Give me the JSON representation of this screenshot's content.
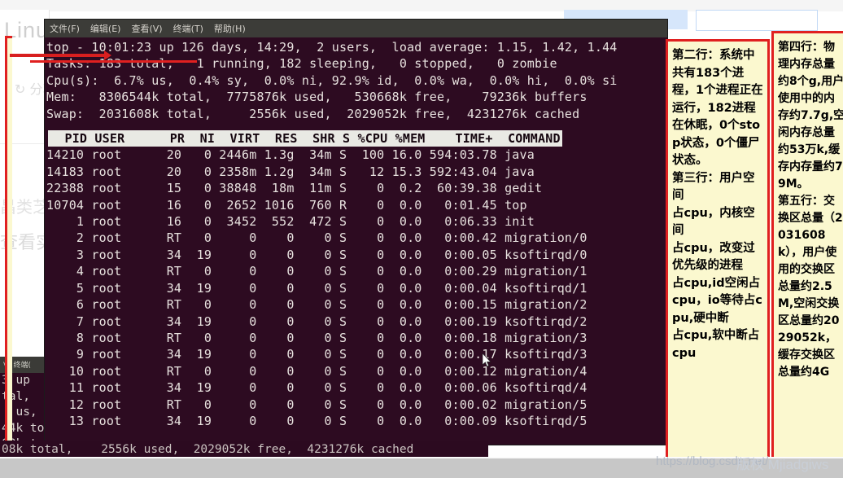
{
  "background": {
    "site_word": "Linux",
    "share_label": "↻ 分享",
    "ghost_text_1": "昌类芝麻",
    "ghost_text_2": "查看实",
    "watermark": "https://blog.csdn.net/",
    "watermark_author": "版权  Mjiadgiws"
  },
  "terminal": {
    "menu": [
      {
        "label": "文件(F)"
      },
      {
        "label": "编辑(E)"
      },
      {
        "label": "查看(V)"
      },
      {
        "label": "终端(T)"
      },
      {
        "label": "帮助(H)"
      }
    ],
    "summary_lines": [
      "top - 10:01:23 up 126 days, 14:29,  2 users,  load average: 1.15, 1.42, 1.44",
      "Tasks: 183 total,   1 running, 182 sleeping,   0 stopped,   0 zombie",
      "Cpu(s):  6.7% us,  0.4% sy,  0.0% ni, 92.9% id,  0.0% wa,  0.0% hi,  0.0% si",
      "Mem:   8306544k total,  7775876k used,   530668k free,    79236k buffers",
      "Swap:  2031608k total,     2556k used,  2029052k free,  4231276k cached"
    ],
    "table_header": "  PID USER      PR  NI  VIRT  RES  SHR S %CPU %MEM    TIME+  COMMAND",
    "rows": [
      "14210 root      20   0 2446m 1.3g  34m S  100 16.0 594:03.78 java",
      "14183 root      20   0 2358m 1.2g  34m S   12 15.3 592:43.04 java",
      "22388 root      15   0 38848  18m  11m S    0  0.2  60:39.38 gedit",
      "10704 root      16   0  2652 1016  760 R    0  0.0   0:01.45 top",
      "    1 root      16   0  3452  552  472 S    0  0.0   0:06.33 init",
      "    2 root      RT   0     0    0    0 S    0  0.0   0:00.42 migration/0",
      "    3 root      34  19     0    0    0 S    0  0.0   0:00.05 ksoftirqd/0",
      "    4 root      RT   0     0    0    0 S    0  0.0   0:00.29 migration/1",
      "    5 root      34  19     0    0    0 S    0  0.0   0:00.04 ksoftirqd/1",
      "    6 root      RT   0     0    0    0 S    0  0.0   0:00.15 migration/2",
      "    7 root      34  19     0    0    0 S    0  0.0   0:00.19 ksoftirqd/2",
      "    8 root      RT   0     0    0    0 S    0  0.0   0:00.18 migration/3",
      "    9 root      34  19     0    0    0 S    0  0.0   0:00.17 ksoftirqd/3",
      "   10 root      RT   0     0    0    0 S    0  0.0   0:00.12 migration/4",
      "   11 root      34  19     0    0    0 S    0  0.0   0:00.06 ksoftirqd/4",
      "   12 root      RT   0     0    0    0 S    0  0.0   0:00.02 migration/5",
      "   13 root      34  19     0    0    0 S    0  0.0   0:00.09 ksoftirqd/5"
    ]
  },
  "back_terminal": {
    "menu_fragment": "V) 终端(",
    "lines": [
      "3 up",
      "tal,",
      "  us,",
      "44k to",
      "08k to"
    ],
    "status_line": "08k total,    2556k used,  2029052k free,  4231276k cached"
  },
  "notes": [
    {
      "id": "note-tasks-cpu",
      "text": "第二行：系统中共有183个进程，1个进程正在运行，182进程在休眠，0个stop状态，0个僵尸状态。\n第三行：用户空间\n占cpu，内核空间\n占cpu，改变过优先级的进程\n占cpu,id空闲占cpu，io等待占cpu,硬中断\n占cpu,软中断占cpu"
    },
    {
      "id": "note-mem-swap",
      "text": "第四行：物理内存总量约8个g,用户使用中的内存约7.7g,空闲内存总量约53万k,缓存内存量约79M。\n第五行：交换区总量（2031608k），用户使用的交换区总量约2.5M,空闲交换区总量约2029052k，缓存交换区总量约4G"
    }
  ],
  "colors": {
    "terminal_bg": "#2d0b21",
    "terminal_fg": "#e8e2df",
    "menubar_bg": "#3c3c38",
    "note_bg": "#fbf8cf",
    "note_border": "#e02020",
    "table_header_bg": "#e9e9e4"
  }
}
